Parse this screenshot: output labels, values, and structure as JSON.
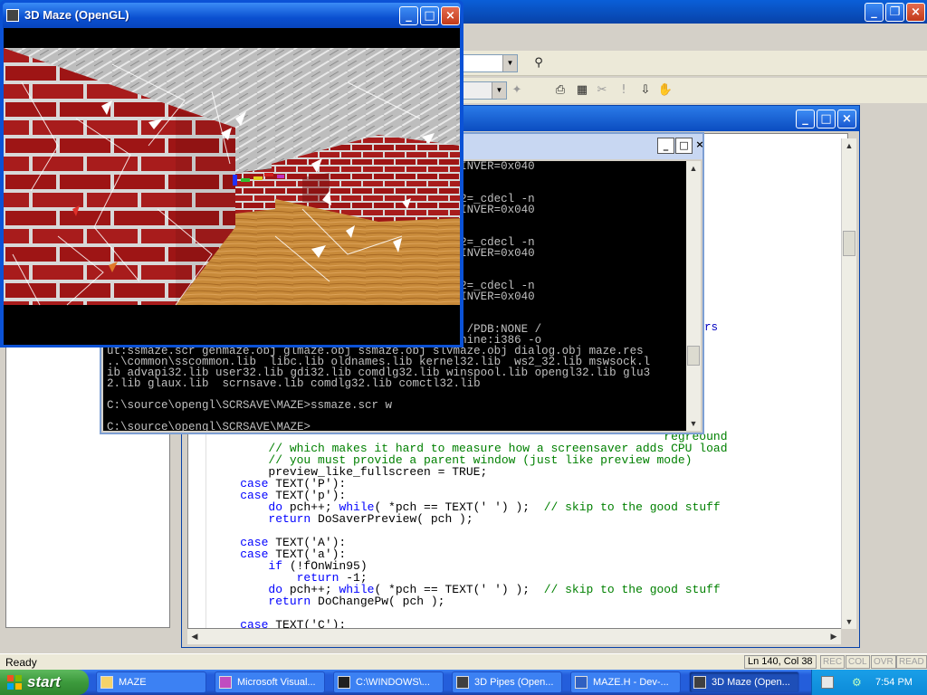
{
  "ide": {
    "status": {
      "ready": "Ready",
      "position": "Ln 140, Col 38",
      "indicators": [
        "REC",
        "COL",
        "OVR",
        "READ"
      ]
    }
  },
  "editor": {
    "code_lines": [
      [
        {
          "t": "                                                                regreound",
          "c": "cm"
        }
      ],
      [
        {
          "t": "        // which makes it hard to measure how a screensaver adds CPU load",
          "c": "cm"
        }
      ],
      [
        {
          "t": "        // you must provide a parent window (just like preview mode)",
          "c": "cm"
        }
      ],
      [
        {
          "t": "        preview_like_fullscreen = TRUE;",
          "c": "tx"
        }
      ],
      [
        {
          "t": "    case ",
          "c": "kw"
        },
        {
          "t": "TEXT('P'):",
          "c": "tx"
        }
      ],
      [
        {
          "t": "    case ",
          "c": "kw"
        },
        {
          "t": "TEXT('p'):",
          "c": "tx"
        }
      ],
      [
        {
          "t": "        do ",
          "c": "kw"
        },
        {
          "t": "pch++; ",
          "c": "tx"
        },
        {
          "t": "while",
          "c": "kw"
        },
        {
          "t": "( *pch == TEXT(' ') );  ",
          "c": "tx"
        },
        {
          "t": "// skip to the good stuff",
          "c": "cm"
        }
      ],
      [
        {
          "t": "        return ",
          "c": "kw"
        },
        {
          "t": "DoSaverPreview( pch );",
          "c": "tx"
        }
      ],
      [
        {
          "t": "",
          "c": "tx"
        }
      ],
      [
        {
          "t": "    case ",
          "c": "kw"
        },
        {
          "t": "TEXT('A'):",
          "c": "tx"
        }
      ],
      [
        {
          "t": "    case ",
          "c": "kw"
        },
        {
          "t": "TEXT('a'):",
          "c": "tx"
        }
      ],
      [
        {
          "t": "        if ",
          "c": "kw"
        },
        {
          "t": "(!fOnWin95)",
          "c": "tx"
        }
      ],
      [
        {
          "t": "            return ",
          "c": "kw"
        },
        {
          "t": "-1;",
          "c": "tx"
        }
      ],
      [
        {
          "t": "        do ",
          "c": "kw"
        },
        {
          "t": "pch++; ",
          "c": "tx"
        },
        {
          "t": "while",
          "c": "kw"
        },
        {
          "t": "( *pch == TEXT(' ') );  ",
          "c": "tx"
        },
        {
          "t": "// skip to the good stuff",
          "c": "cm"
        }
      ],
      [
        {
          "t": "        return ",
          "c": "kw"
        },
        {
          "t": "DoChangePw( pch );",
          "c": "tx"
        }
      ],
      [
        {
          "t": "",
          "c": "tx"
        }
      ],
      [
        {
          "t": "    case ",
          "c": "kw"
        },
        {
          "t": "TEXT('C'):",
          "c": "tx"
        }
      ]
    ]
  },
  "console": {
    "lines": [
      "                                 WIN32_IE=0x0300 -DWINVER=0x040",
      "",
      "",
      "                                 PI1=_cdecl -DCRTAPI2=_cdecl -n",
      "                                 WIN32_IE=0x0300 -DWINVER=0x040",
      "",
      "",
      "                                 PI1=_cdecl -DCRTAPI2=_cdecl -n",
      "                                 WIN32_IE=0x0300 -DWINVER=0x040",
      "",
      "",
      "                                 PI1=_cdecl -DCRTAPI2=_cdecl -n",
      "                                 WIN32_IE=0x0300 -DWINVER=0x040",
      "",
      "",
      "                                 LIB /INCREMENTAL:NO /PDB:NONE /",
      "                                 MainCRTStartup -machine:i386 -o",
      "ut:ssmaze.scr genmaze.obj glmaze.obj ssmaze.obj slvmaze.obj dialog.obj maze.res",
      "..\\common\\sscommon.lib  libc.lib oldnames.lib kernel32.lib  ws2_32.lib mswsock.l",
      "ib advapi32.lib user32.lib gdi32.lib comdlg32.lib winspool.lib opengl32.lib glu3",
      "2.lib glaux.lib  scrnsave.lib comdlg32.lib comctl32.lib",
      "",
      "C:\\source\\opengl\\SCRSAVE\\MAZE>ssmaze.scr w",
      "",
      "C:\\source\\opengl\\SCRSAVE\\MAZE>"
    ],
    "overflow_text": "rs"
  },
  "maze": {
    "title": "3D Maze (OpenGL)"
  },
  "taskbar": {
    "start_label": "start",
    "tasks": [
      {
        "label": "MAZE",
        "icon": "folder-icon",
        "active": false
      },
      {
        "label": "Microsoft Visual...",
        "icon": "visual-studio-icon",
        "active": false
      },
      {
        "label": "C:\\WINDOWS\\...",
        "icon": "command-prompt-icon",
        "active": false
      },
      {
        "label": "3D Pipes (Open...",
        "icon": "opengl-app-icon",
        "active": false
      },
      {
        "label": "MAZE.H - Dev-...",
        "icon": "dev-cpp-icon",
        "active": false
      },
      {
        "label": "3D Maze (Open...",
        "icon": "opengl-app-icon",
        "active": true
      }
    ],
    "clock": "7:54 PM"
  },
  "colors": {
    "xp_blue": "#245edb",
    "brick": "#9e1515",
    "mortar": "#d8d8d8",
    "floor": "#c88a3a"
  }
}
